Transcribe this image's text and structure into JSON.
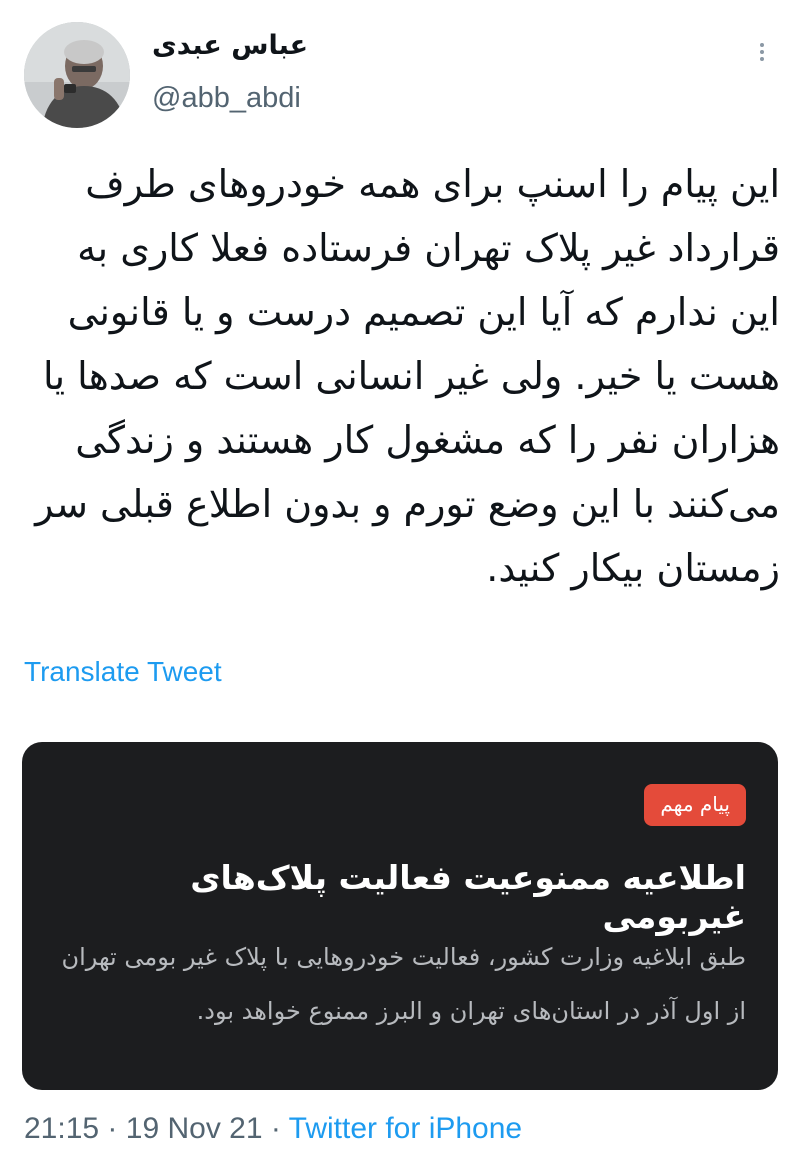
{
  "author": {
    "name": "عباس عبدی",
    "handle": "@abb_abdi",
    "avatar_icon": "user-photo-icon"
  },
  "menu": {
    "icon": "more-vertical-icon"
  },
  "tweet": {
    "text": "این پیام را اسنپ برای همه خودروهای طرف قرارداد غیر پلاک تهران فرستاده فعلا کاری به این ندارم که آیا این تصمیم درست و یا قانونی هست یا خیر. ولی غیر انسانی است که صدها یا هزاران نفر را که مشغول کار هستند و زندگی می‌کنند با این وضع تورم و بدون اطلاع قبلی سر زمستان بیکار کنید.",
    "translate_label": "Translate Tweet"
  },
  "media": {
    "badge": "پیام مهم",
    "badge_color": "#e44b3a",
    "background_color": "#1c1d1f",
    "headline": "اطلاعیه ممنوعیت فعالیت پلاک‌های غیربومی",
    "body": "طبق ابلاغیه وزارت کشور، فعالیت خودروهایی با پلاک غیر بومی تهران از اول آذر در استان‌های تهران و البرز ممنوع خواهد بود."
  },
  "footer": {
    "time": "21:15",
    "separator": "·",
    "date": "19 Nov 21",
    "source": "Twitter for iPhone",
    "link_color": "#1d9bf0"
  }
}
